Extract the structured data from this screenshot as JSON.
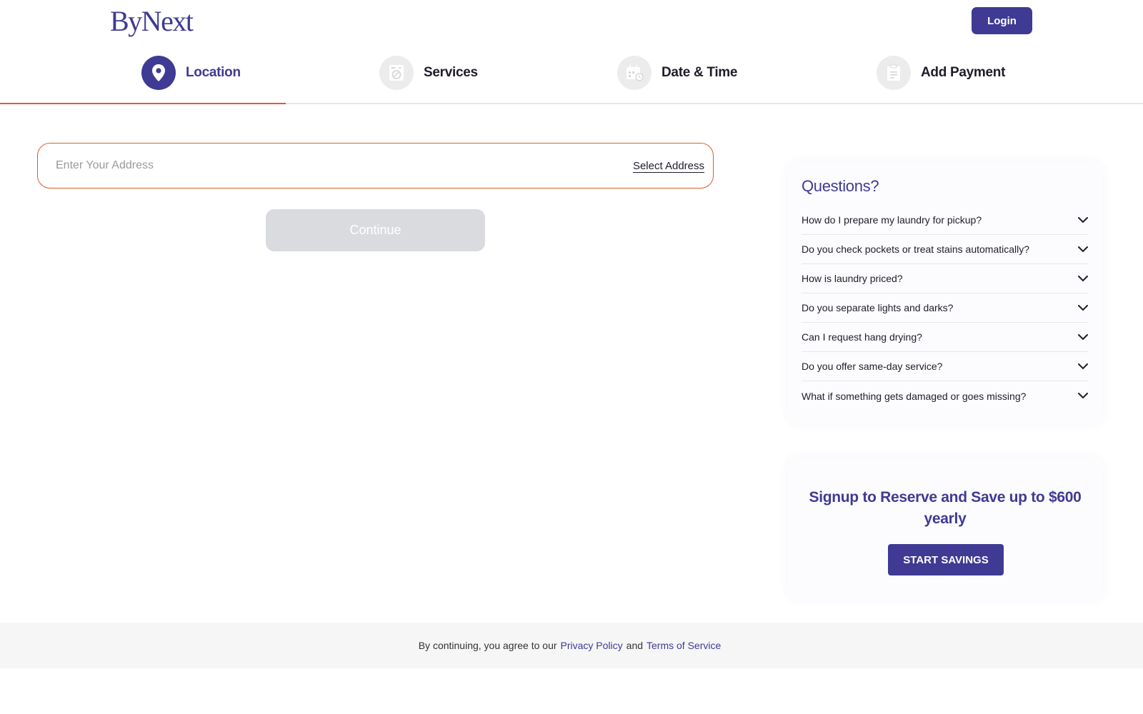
{
  "header": {
    "logo": "ByNext",
    "login_label": "Login"
  },
  "steps": [
    {
      "label": "Location",
      "icon": "location-pin-icon",
      "active": true
    },
    {
      "label": "Services",
      "icon": "washing-machine-icon",
      "active": false
    },
    {
      "label": "Date & Time",
      "icon": "calendar-clock-icon",
      "active": false
    },
    {
      "label": "Add Payment",
      "icon": "clipboard-icon",
      "active": false
    }
  ],
  "address": {
    "placeholder": "Enter Your Address",
    "select_label": "Select Address"
  },
  "continue_label": "Continue",
  "faq": {
    "title": "Questions?",
    "items": [
      "How do I prepare my laundry for pickup?",
      "Do you check pockets or treat stains automatically?",
      "How is laundry priced?",
      "Do you separate lights and darks?",
      "Can I request hang drying?",
      "Do you offer same-day service?",
      "What if something gets damaged or goes missing?"
    ]
  },
  "signup": {
    "title": "Signup to Reserve and Save up to $600 yearly",
    "button_label": "START SAVINGS"
  },
  "footer": {
    "text": "By continuing, you agree to our",
    "privacy_label": "Privacy Policy",
    "and_text": "and",
    "terms_label": "Terms of Service"
  },
  "colors": {
    "brand": "#3f3a94",
    "accent": "#e05a2b",
    "disabled": "#d9dbde"
  }
}
